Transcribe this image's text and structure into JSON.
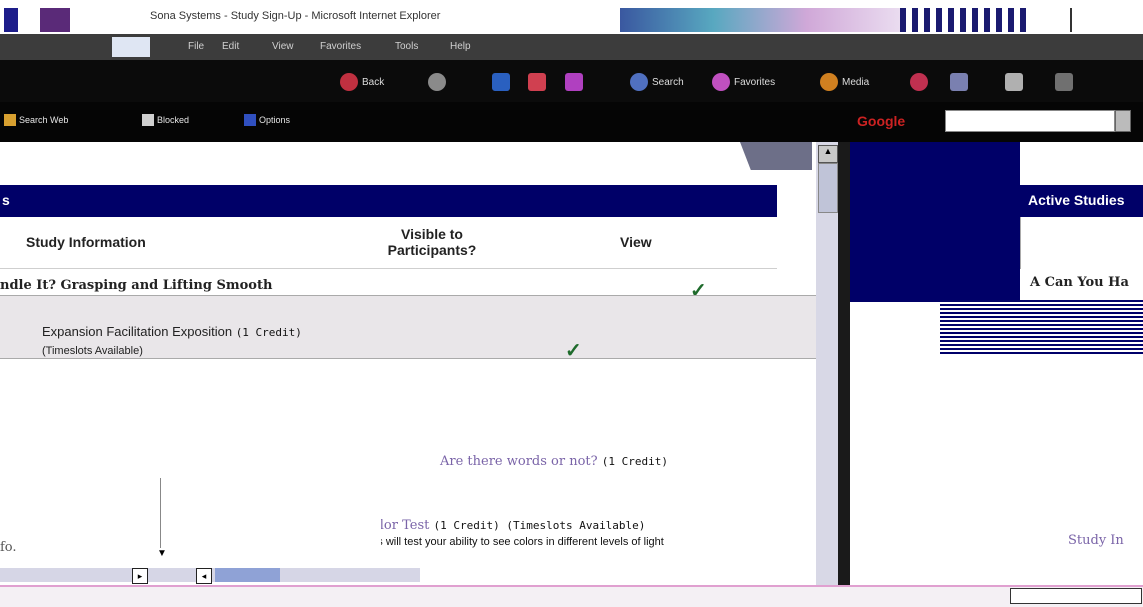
{
  "window": {
    "title": "Sona Systems - Study Sign-Up - Microsoft Internet Explorer"
  },
  "menu": {
    "items": [
      "File",
      "Edit",
      "View",
      "Favorites",
      "Tools",
      "Help"
    ]
  },
  "toolbar": {
    "back": "Back",
    "search": "Search",
    "favorites": "Favorites",
    "media": "Media"
  },
  "links": {
    "search_web": "Search Web",
    "blocked": "Blocked",
    "options": "Options"
  },
  "google": {
    "label": "Google"
  },
  "left": {
    "section_title": "s",
    "col_study": "Study Information",
    "col_visible": "Visible to Participants?",
    "col_view": "View",
    "rows": [
      {
        "title": "ndle It? Grasping and Lifting Smooth",
        "credit": ""
      },
      {
        "title": "Expansion Facilitation Exposition",
        "credit": "(1 Credit)",
        "sub": "(Timeslots Available)"
      },
      {
        "title": "Are there words or not?",
        "credit": "(1 Credit)"
      },
      {
        "title": "Color Test",
        "credit": "(1 Credit) (Timeslots Available)",
        "desc": "This will test your ability to see colors in different levels of light"
      }
    ],
    "left_cut": "fo."
  },
  "right": {
    "header": "Active Studies",
    "item1": "A Can You Ha",
    "link": "Study In"
  },
  "icons": {
    "check": "✓"
  },
  "colors": {
    "navy": "#000068",
    "study_link": "#7a64a8",
    "check_green": "#1f6b2c"
  }
}
